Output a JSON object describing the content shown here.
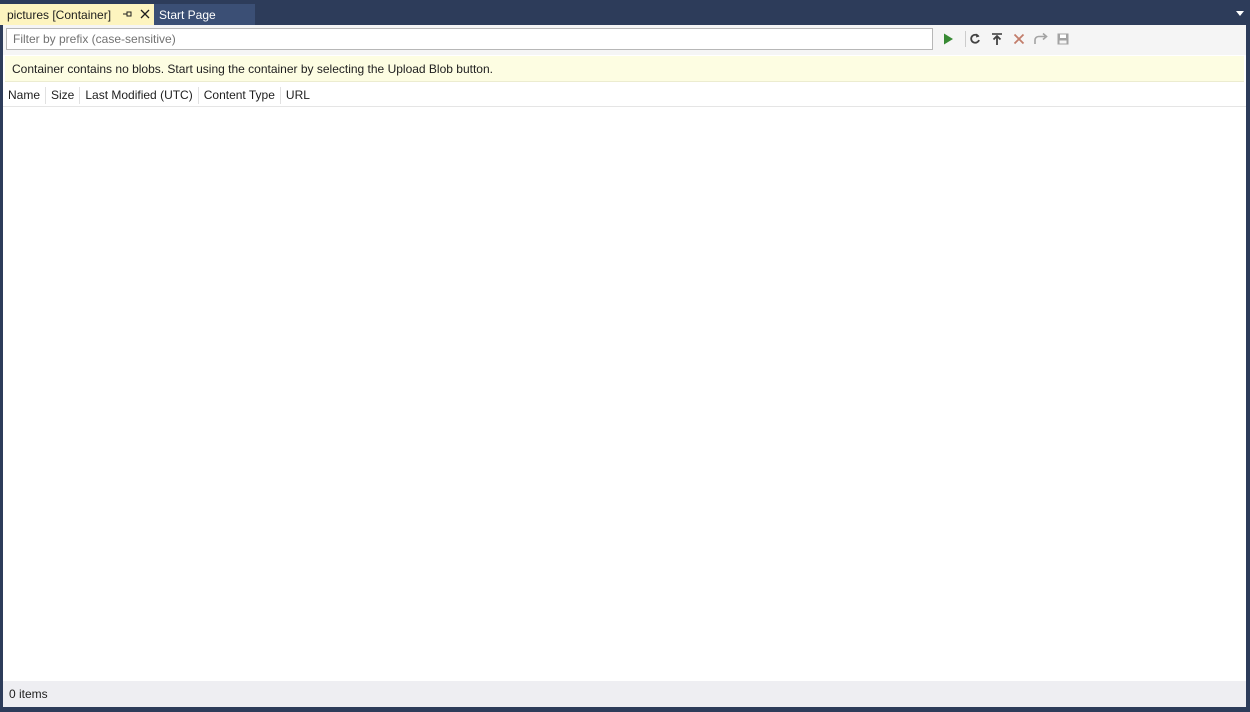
{
  "tabs": [
    {
      "label": "pictures [Container]",
      "active": true
    },
    {
      "label": "Start Page",
      "active": false
    }
  ],
  "filter": {
    "value": "",
    "placeholder": "Filter by prefix (case-sensitive)"
  },
  "toolbar": {
    "icons": [
      "run-icon",
      "refresh-icon",
      "upload-icon",
      "delete-icon",
      "redo-icon",
      "save-icon"
    ]
  },
  "notice": {
    "text": "Container contains no blobs. Start using the container by selecting the Upload Blob button."
  },
  "table": {
    "columns": [
      "Name",
      "Size",
      "Last Modified (UTC)",
      "Content Type",
      "URL"
    ],
    "rows": []
  },
  "status": {
    "text": "0 items"
  },
  "colors": {
    "tab_active": "#fdf4bf",
    "tab_inactive": "#3b4f75",
    "frame": "#2d3c5a",
    "run": "#388a34",
    "delete": "#c27d6b"
  }
}
